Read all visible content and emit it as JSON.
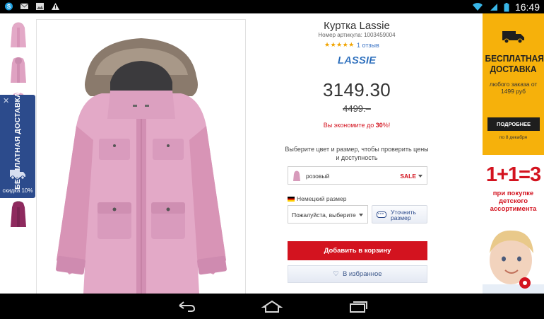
{
  "status_bar": {
    "time": "16:49",
    "left_icons": [
      "skype-icon",
      "mail-icon",
      "image-icon",
      "warning-icon"
    ],
    "right_icons": [
      "wifi-icon",
      "signal-icon",
      "battery-icon"
    ]
  },
  "product": {
    "title": "Куртка Lassie",
    "sku": "Номер артикула: 1003459004",
    "stars": "★★★★★",
    "rating": 5,
    "reviews_link": "1 отзыв",
    "brand_logo_text": "LASSIE",
    "price": "3149.30",
    "old_price": "4499.–",
    "savings_prefix": "Вы экономите до ",
    "savings_value": "30",
    "savings_suffix": "%!",
    "select_prompt": "Выберите цвет и размер, чтобы проверить цены и доступность",
    "color_selected": "розовый",
    "color_sale": "SALE",
    "size_system": "Немецкий размер",
    "size_placeholder": "Пожалуйста, выберите",
    "size_info_button": "Уточнить размер",
    "add_to_cart": "Добавить в корзину",
    "wishlist": "В избранное"
  },
  "side_tab": {
    "close": "✕",
    "text": "БЕСПЛАТНАЯ ДОСТАВКА",
    "plus": "+",
    "discount": "скидка 10%"
  },
  "banner_delivery": {
    "title": "БЕСПЛАТНАЯ ДОСТАВКА",
    "subtitle": "любого заказа от 1499 руб",
    "button": "ПОДРОБНЕЕ",
    "date": "по 8 декабря"
  },
  "banner_promo": {
    "equation": "1+1=3",
    "text": "при покупке детского ассортимента"
  },
  "colors": {
    "accent_red": "#d3131f",
    "brand_blue": "#2c4b8c",
    "banner_yellow": "#f6b10b",
    "jacket_pink": "#e3a9c7"
  },
  "nav_bar": {
    "icons": [
      "back-icon",
      "home-icon",
      "recent-apps-icon"
    ]
  }
}
